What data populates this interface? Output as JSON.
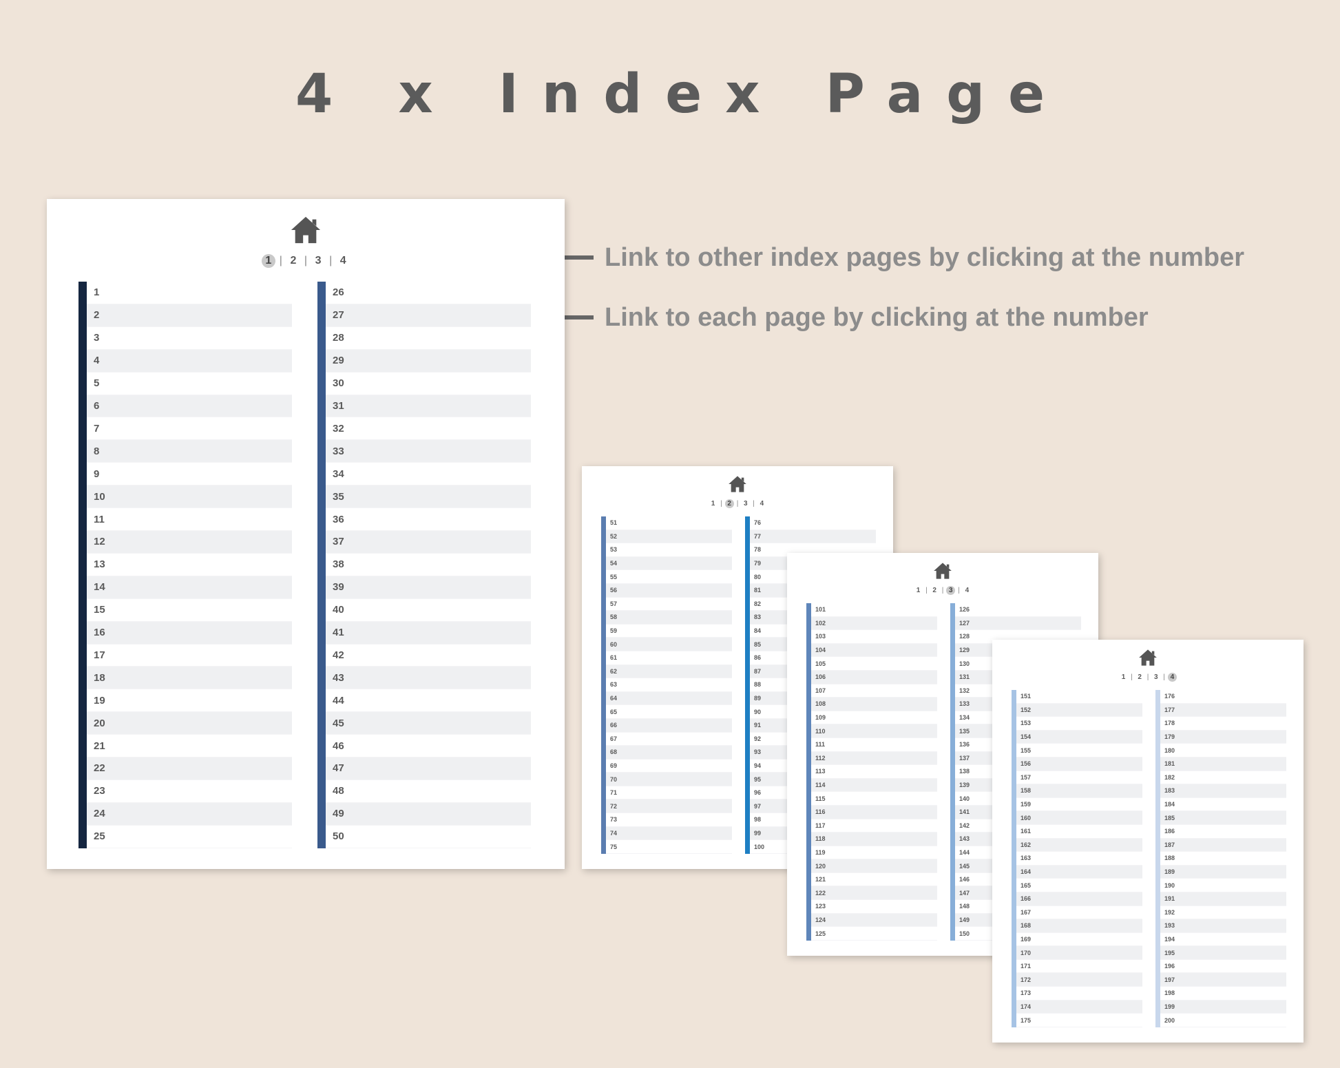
{
  "header": {
    "title": "4 x Index Page"
  },
  "annotations": {
    "index_link_note": "Link to other index pages by clicking at the number",
    "page_link_note": "Link to each page by clicking at the number"
  },
  "nav": {
    "labels": [
      "1",
      "2",
      "3",
      "4"
    ],
    "separator": "|"
  },
  "icons": {
    "home": "home-icon"
  },
  "colors": {
    "background": "#efe4d9",
    "title": "#5b5b5b",
    "note": "#8c8c8c",
    "row_alt": "#eff0f2"
  },
  "pages": [
    {
      "active": 1,
      "columns": [
        {
          "start": 1,
          "end": 25,
          "color": "#152640"
        },
        {
          "start": 26,
          "end": 50,
          "color": "#3a5a8c"
        }
      ]
    },
    {
      "active": 2,
      "columns": [
        {
          "start": 51,
          "end": 75,
          "color": "#5b7db0"
        },
        {
          "start": 76,
          "end": 100,
          "color": "#1e7fc3"
        }
      ]
    },
    {
      "active": 3,
      "columns": [
        {
          "start": 101,
          "end": 125,
          "color": "#5f86ba"
        },
        {
          "start": 126,
          "end": 150,
          "color": "#87aed8"
        }
      ]
    },
    {
      "active": 4,
      "columns": [
        {
          "start": 151,
          "end": 175,
          "color": "#a6c3e4"
        },
        {
          "start": 176,
          "end": 200,
          "color": "#c8d7ec"
        }
      ]
    }
  ]
}
